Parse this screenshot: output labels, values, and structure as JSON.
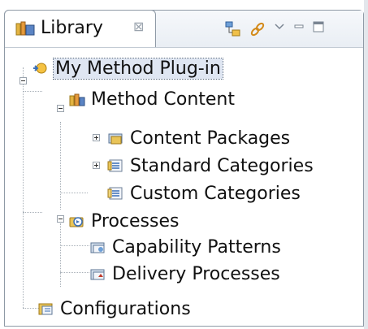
{
  "view": {
    "tab_label": "Library",
    "close_glyph": "⊠"
  },
  "tree": {
    "root": "My Method Plug-in",
    "method_content": "Method Content",
    "content_packages": "Content Packages",
    "standard_categories": "Standard Categories",
    "custom_categories": "Custom Categories",
    "processes": "Processes",
    "capability_patterns": "Capability Patterns",
    "delivery_processes": "Delivery Processes",
    "configurations": "Configurations"
  },
  "colors": {
    "accent": "#3b6fb6",
    "folder": "#e2b84a",
    "selection": "#dfe6f2"
  }
}
